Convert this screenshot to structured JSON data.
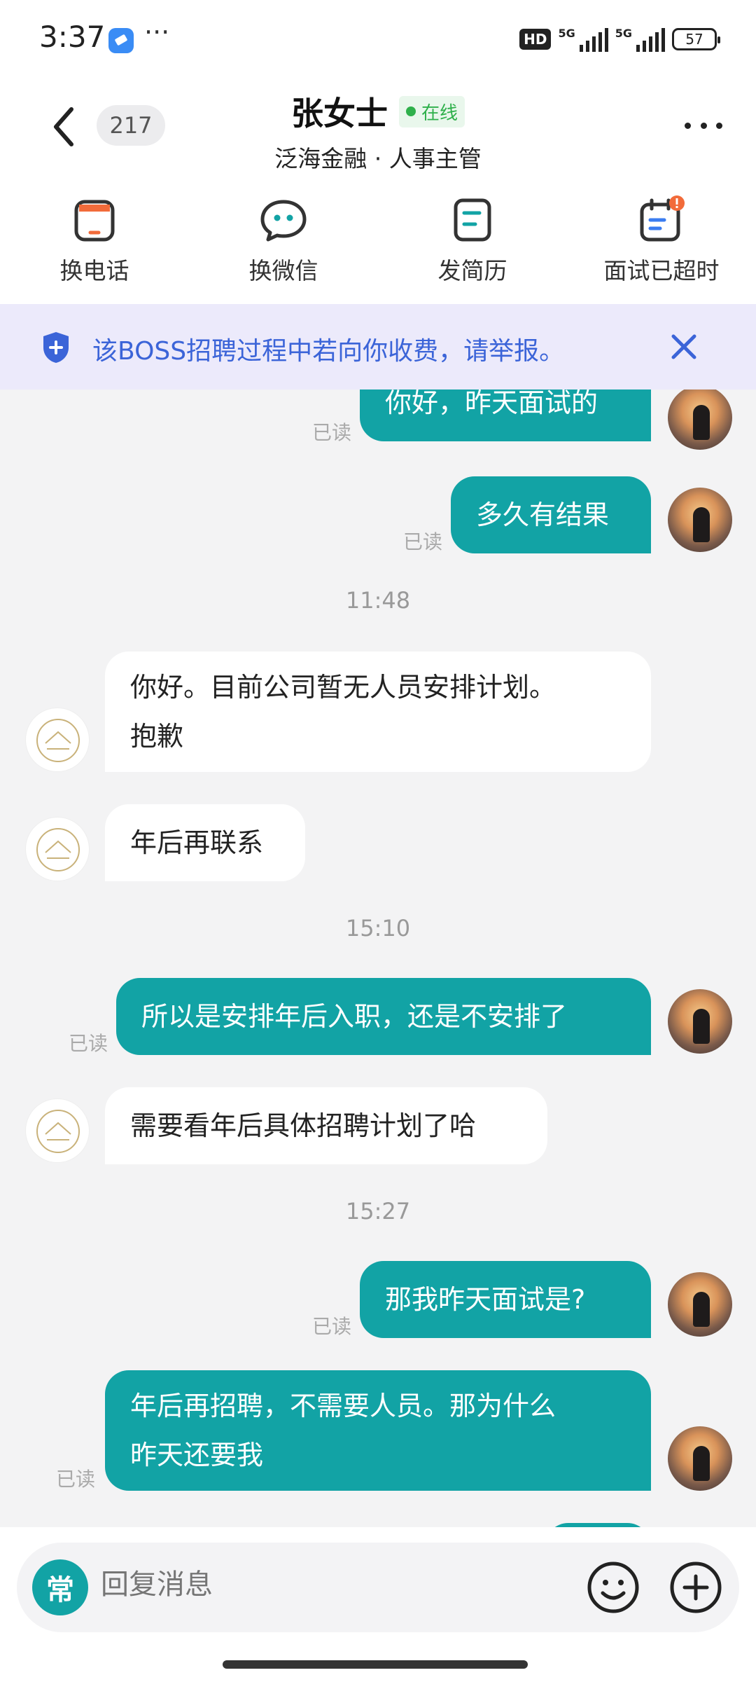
{
  "status_bar": {
    "time": "3:37",
    "network_badge": "HD",
    "signal_1": "5G",
    "signal_2": "5G",
    "battery": "57"
  },
  "header": {
    "unread_count": "217",
    "contact_name": "张女士",
    "online_status": "在线",
    "subtitle": "泛海金融 · 人事主管"
  },
  "actions": [
    {
      "label": "换电话",
      "icon": "phone-card-icon"
    },
    {
      "label": "换微信",
      "icon": "wechat-icon"
    },
    {
      "label": "发简历",
      "icon": "resume-icon"
    },
    {
      "label": "面试已超时",
      "icon": "interview-calendar-icon"
    }
  ],
  "notice": {
    "text": "该BOSS招聘过程中若向你收费，请举报。"
  },
  "messages": {
    "m1": {
      "text": "你好，昨天面试的",
      "read": "已读"
    },
    "m2": {
      "text": "多久有结果",
      "read": "已读"
    },
    "t1": "11:48",
    "m3": {
      "line1": "你好。目前公司暂无人员安排计划。",
      "line2": "抱歉"
    },
    "m4": {
      "text": "年后再联系"
    },
    "t2": "15:10",
    "m5": {
      "text": "所以是安排年后入职，还是不安排了",
      "read": "已读"
    },
    "m6": {
      "text": "需要看年后具体招聘计划了哈"
    },
    "t3": "15:27",
    "m7": {
      "text": "那我昨天面试是?",
      "read": "已读"
    },
    "m8": {
      "line1": "年后再招聘，不需要人员。那为什么",
      "line2": "昨天还要我",
      "read": "已读"
    }
  },
  "input": {
    "quick_label": "常",
    "placeholder": "回复消息"
  },
  "colors": {
    "accent": "#12a3a5",
    "notice_bg": "#eceafb",
    "notice_text": "#3b64d8",
    "online": "#2fb04b",
    "alert": "#f26b3a"
  }
}
